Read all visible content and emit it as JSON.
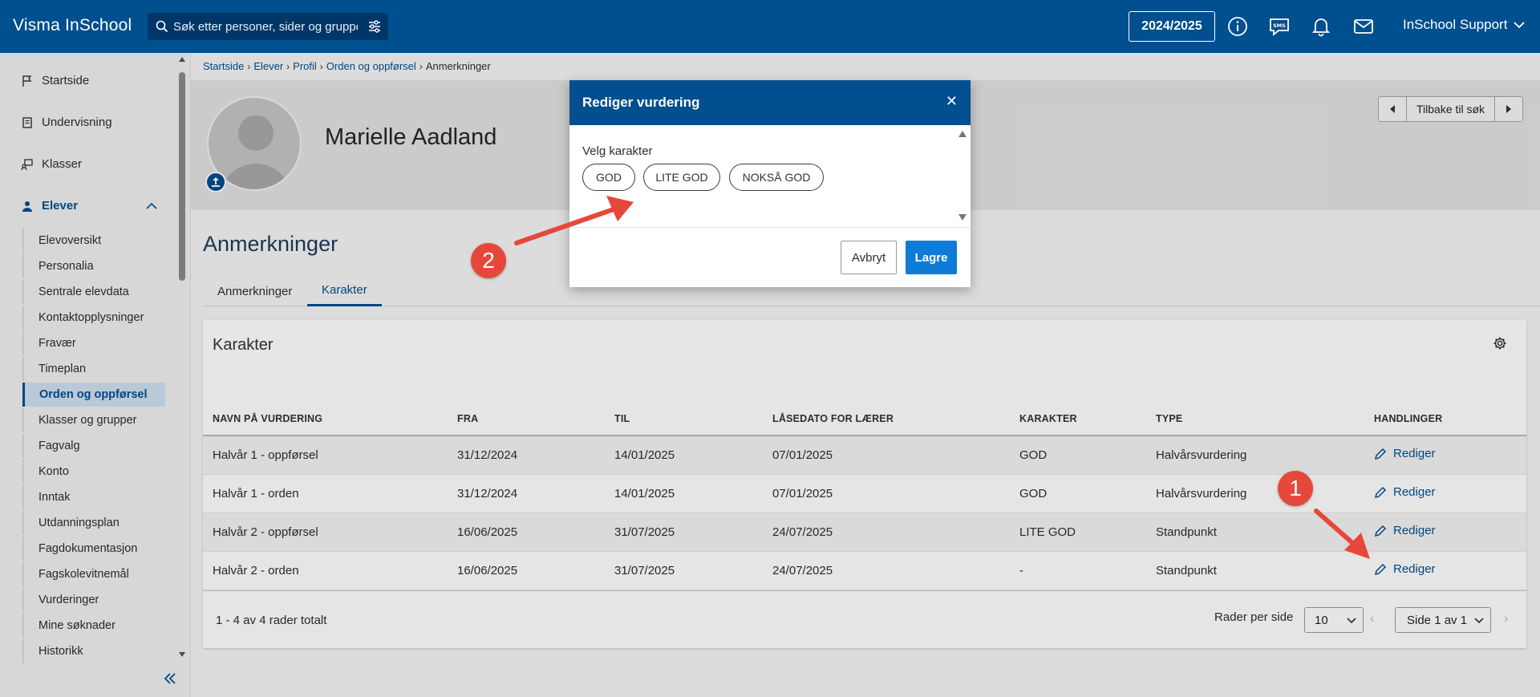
{
  "app": {
    "brand": "Visma InSchool",
    "search_placeholder": "Søk etter personer, sider og grupper",
    "school_year": "2024/2025",
    "user_name": "InSchool Support"
  },
  "sidebar": {
    "top_items": [
      {
        "label": "Startside",
        "icon": "flag-icon"
      },
      {
        "label": "Undervisning",
        "icon": "book-icon"
      },
      {
        "label": "Klasser",
        "icon": "classroom-icon"
      },
      {
        "label": "Elever",
        "icon": "student-icon"
      }
    ],
    "sub_items": [
      "Elevoversikt",
      "Personalia",
      "Sentrale elevdata",
      "Kontaktopplysninger",
      "Fravær",
      "Timeplan",
      "Orden og oppførsel",
      "Klasser og grupper",
      "Fagvalg",
      "Konto",
      "Inntak",
      "Utdanningsplan",
      "Fagdokumentasjon",
      "Fagskolevitnemål",
      "Vurderinger",
      "Mine søknader",
      "Historikk"
    ]
  },
  "breadcrumb": [
    "Startside",
    "Elever",
    "Profil",
    "Orden og oppførsel",
    "Anmerkninger"
  ],
  "profile": {
    "name": "Marielle Aadland",
    "back_label": "Tilbake til søk"
  },
  "page": {
    "heading": "Anmerkninger",
    "tabs": [
      "Anmerkninger",
      "Karakter"
    ]
  },
  "table": {
    "title": "Karakter",
    "columns": [
      "NAVN PÅ VURDERING",
      "FRA",
      "TIL",
      "LÅSEDATO FOR LÆRER",
      "KARAKTER",
      "TYPE",
      "HANDLINGER"
    ],
    "rows": [
      {
        "name": "Halvår 1 - oppførsel",
        "from": "31/12/2024",
        "to": "14/01/2025",
        "lock": "07/01/2025",
        "grade": "GOD",
        "type": "Halvårsvurdering",
        "action": "Rediger"
      },
      {
        "name": "Halvår 1 - orden",
        "from": "31/12/2024",
        "to": "14/01/2025",
        "lock": "07/01/2025",
        "grade": "GOD",
        "type": "Halvårsvurdering",
        "action": "Rediger"
      },
      {
        "name": "Halvår 2 - oppførsel",
        "from": "16/06/2025",
        "to": "31/07/2025",
        "lock": "24/07/2025",
        "grade": "LITE GOD",
        "type": "Standpunkt",
        "action": "Rediger"
      },
      {
        "name": "Halvår 2 - orden",
        "from": "16/06/2025",
        "to": "31/07/2025",
        "lock": "24/07/2025",
        "grade": "-",
        "type": "Standpunkt",
        "action": "Rediger"
      }
    ],
    "footer_count": "1 - 4 av 4 rader totalt",
    "rows_per_page_label": "Rader per side",
    "rows_per_page": "10",
    "page_label": "Side 1 av 1"
  },
  "modal": {
    "title": "Rediger vurdering",
    "label": "Velg karakter",
    "grades": [
      "GOD",
      "LITE GOD",
      "NOKSÅ GOD"
    ],
    "cancel": "Avbryt",
    "save": "Lagre"
  },
  "callouts": [
    "1",
    "2"
  ],
  "colors": {
    "header": "#004f8f",
    "accent": "#0e7bd6",
    "callout": "#e5483a"
  }
}
